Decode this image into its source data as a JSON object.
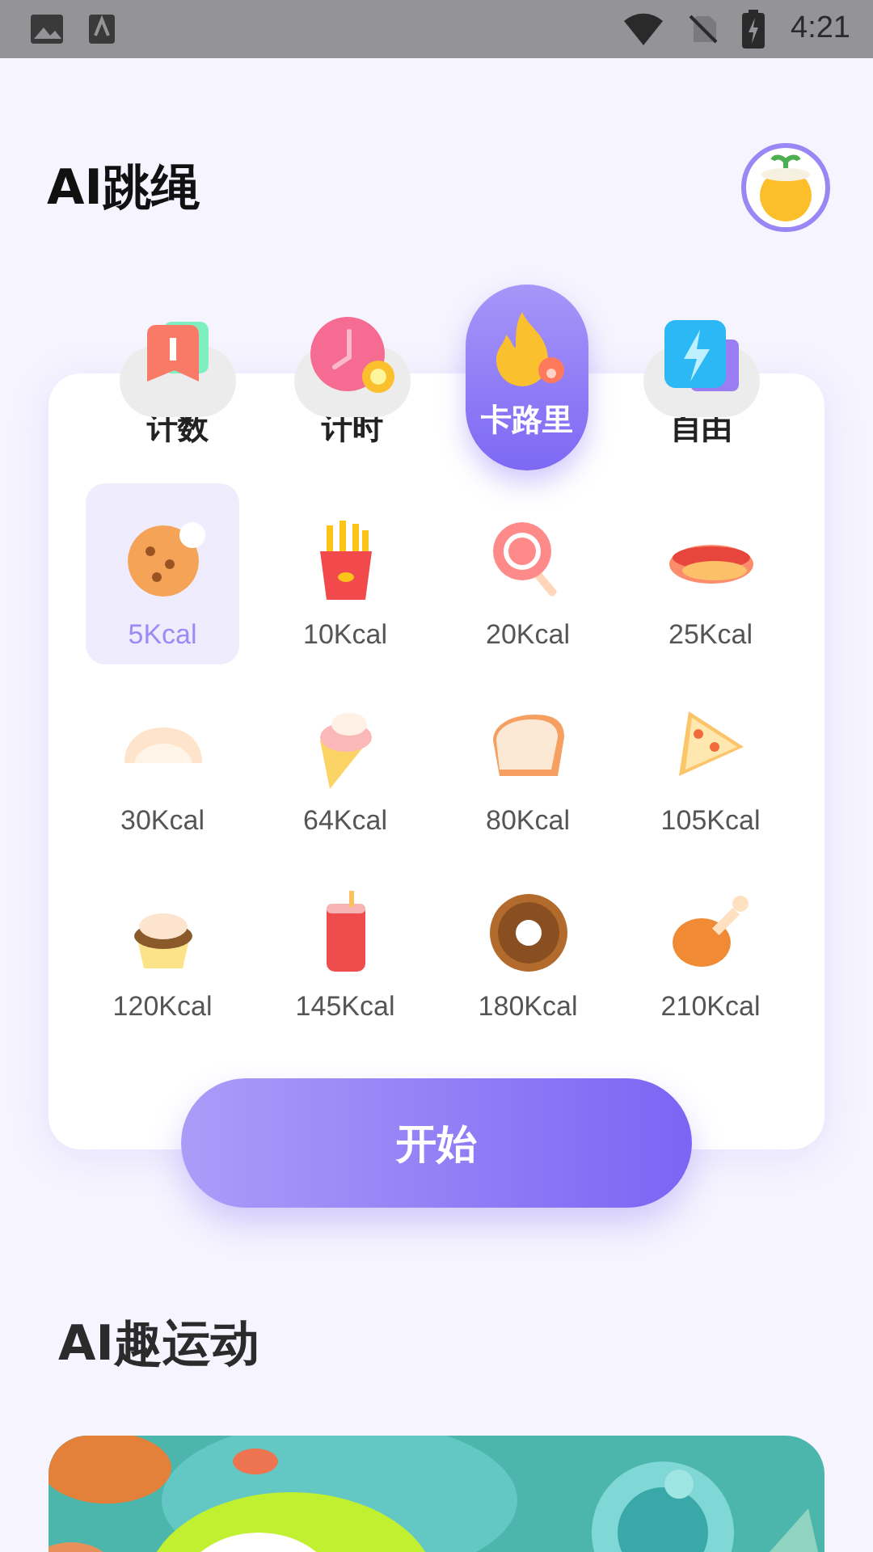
{
  "status_bar": {
    "time": "4:21"
  },
  "header": {
    "title": "AI跳绳"
  },
  "modes": [
    {
      "label": "计数",
      "selected": false
    },
    {
      "label": "计时",
      "selected": false
    },
    {
      "label": "卡路里",
      "selected": true
    },
    {
      "label": "自由",
      "selected": false
    }
  ],
  "foods": [
    {
      "label": "5Kcal",
      "selected": true
    },
    {
      "label": "10Kcal",
      "selected": false
    },
    {
      "label": "20Kcal",
      "selected": false
    },
    {
      "label": "25Kcal",
      "selected": false
    },
    {
      "label": "30Kcal",
      "selected": false
    },
    {
      "label": "64Kcal",
      "selected": false
    },
    {
      "label": "80Kcal",
      "selected": false
    },
    {
      "label": "105Kcal",
      "selected": false
    },
    {
      "label": "120Kcal",
      "selected": false
    },
    {
      "label": "145Kcal",
      "selected": false
    },
    {
      "label": "180Kcal",
      "selected": false
    },
    {
      "label": "210Kcal",
      "selected": false
    }
  ],
  "start_button": {
    "label": "开始"
  },
  "section": {
    "title": "AI趣运动"
  }
}
